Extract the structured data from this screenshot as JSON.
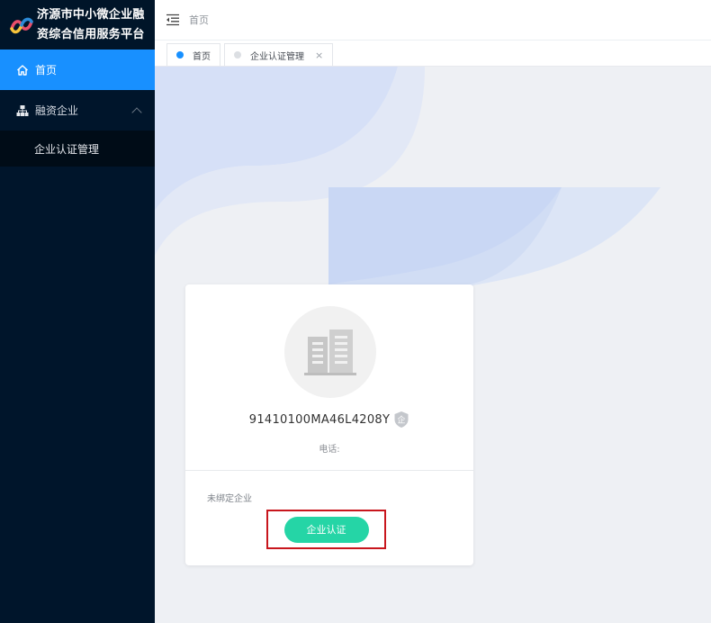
{
  "sidebar": {
    "title": "济源市中小微企业融\n资综合信用服务平台",
    "menu": [
      {
        "label": "首页",
        "icon": "home-icon",
        "active": true
      },
      {
        "label": "融资企业",
        "icon": "sitemap-icon",
        "expanded": true,
        "children": [
          {
            "label": "企业认证管理"
          }
        ]
      }
    ]
  },
  "header": {
    "breadcrumb": "首页",
    "fold_icon": "menu-fold-icon"
  },
  "tabs": [
    {
      "label": "首页",
      "active": true
    },
    {
      "label": "企业认证管理",
      "active": false,
      "close": "×"
    }
  ],
  "card": {
    "credit_code": "91410100MA46L4208Y",
    "badge_text": "企",
    "phone_label": "电话:",
    "status": "未绑定企业",
    "button_label": "企业认证"
  },
  "colors": {
    "sidebar_bg": "#00152b",
    "active_menu": "#1890ff",
    "tab_active_dot": "#1890ff",
    "tab_inactive_dot": "#dcdfe3",
    "button": "#25d5a6",
    "highlight_border": "#c8161d"
  }
}
